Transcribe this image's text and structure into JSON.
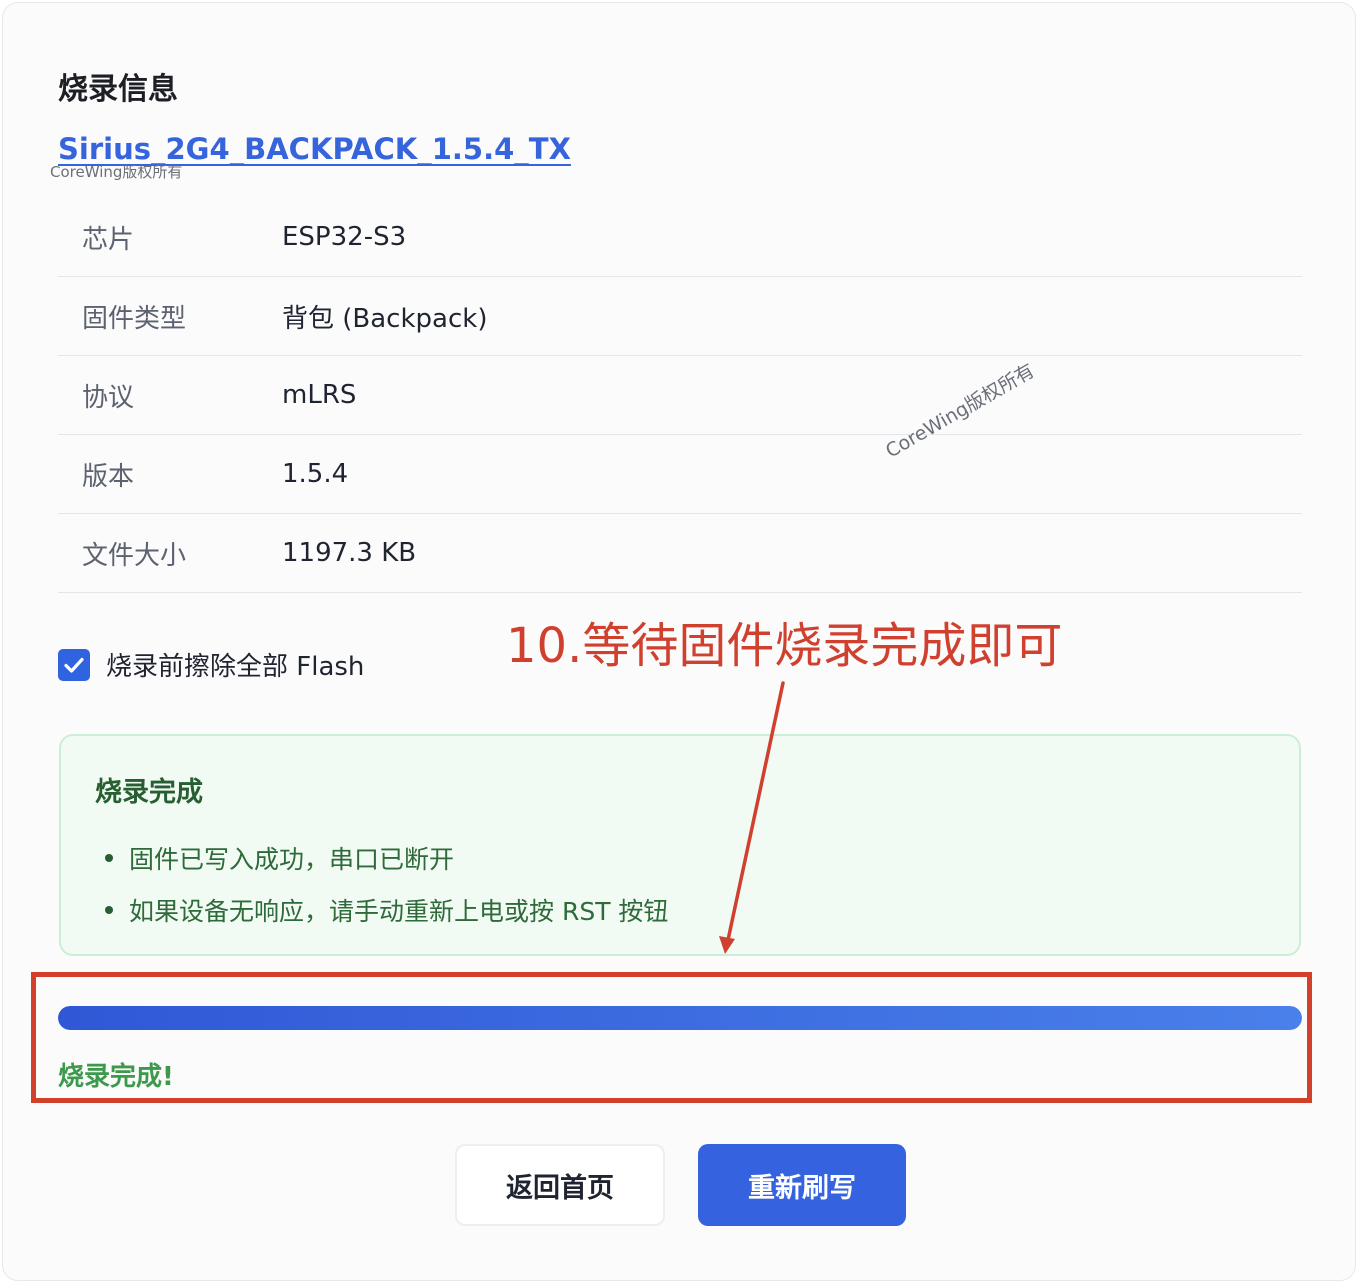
{
  "title": "烧录信息",
  "firmware_name": "Sirius_2G4_BACKPACK_1.5.4_TX",
  "watermark": "CoreWing版权所有",
  "info": [
    {
      "key": "芯片",
      "value": "ESP32-S3"
    },
    {
      "key": "固件类型",
      "value": "背包 (Backpack)"
    },
    {
      "key": "协议",
      "value": "mLRS"
    },
    {
      "key": "版本",
      "value": "1.5.4"
    },
    {
      "key": "文件大小",
      "value": "1197.3 KB"
    }
  ],
  "erase_option": {
    "label": "烧录前擦除全部 Flash",
    "checked": true
  },
  "annotation": {
    "text": "10.等待固件烧录完成即可",
    "color": "#d0402f"
  },
  "done_panel": {
    "title": "烧录完成",
    "items": [
      "固件已写入成功，串口已断开",
      "如果设备无响应，请手动重新上电或按 RST 按钮"
    ]
  },
  "progress": {
    "percent": 100,
    "status": "烧录完成!"
  },
  "buttons": {
    "home": "返回首页",
    "reflash": "重新刷写"
  },
  "colors": {
    "accent": "#3563e0",
    "success": "#3d9a4c",
    "annotation": "#d0402f"
  },
  "icons": {
    "checkbox": "check-icon"
  }
}
